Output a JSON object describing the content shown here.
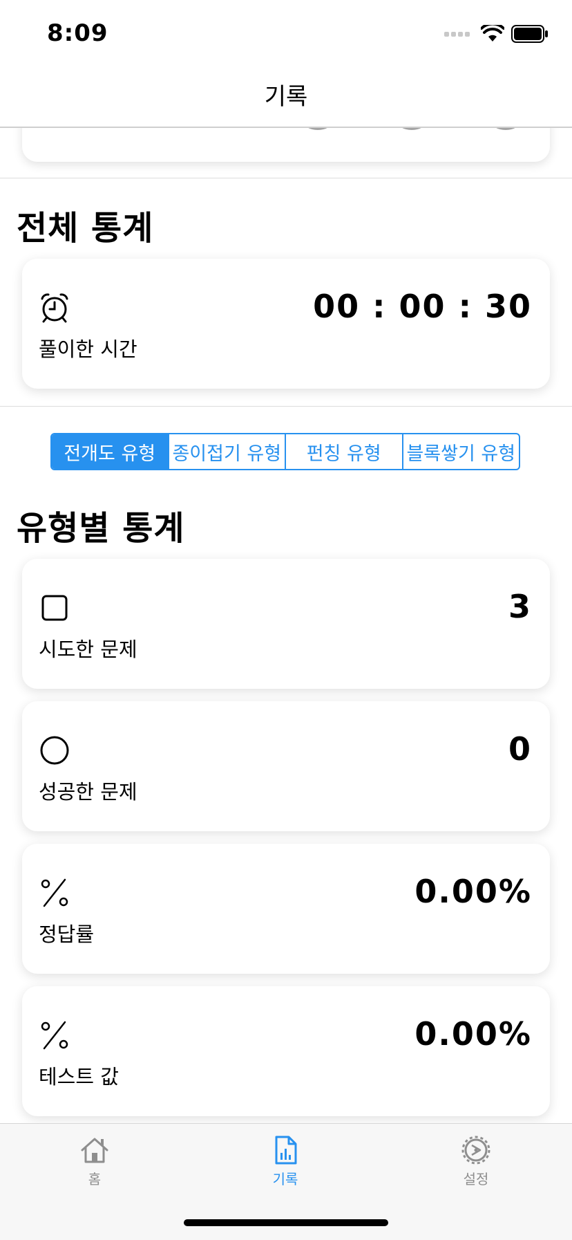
{
  "status_bar": {
    "time": "8:09"
  },
  "nav": {
    "title": "기록"
  },
  "overall_stats": {
    "title": "전체 통계",
    "time_card": {
      "icon": "alarm-clock-icon",
      "label": "풀이한 시간",
      "value": "00 : 00 : 30"
    }
  },
  "type_segments": {
    "items": [
      "전개도 유형",
      "종이접기 유형",
      "펀칭 유형",
      "블록쌓기 유형"
    ],
    "selected": "전개도 유형"
  },
  "type_stats": {
    "title": "유형별 통계",
    "cards": [
      {
        "icon": "square-icon",
        "label": "시도한 문제",
        "value": "3"
      },
      {
        "icon": "circle-icon",
        "label": "성공한 문제",
        "value": "0"
      },
      {
        "icon": "percent-icon",
        "label": "정답률",
        "value": "0.00%"
      },
      {
        "icon": "percent-icon",
        "label": "테스트 값",
        "value": "0.00%"
      }
    ]
  },
  "tab_bar": {
    "items": [
      {
        "label": "홈",
        "icon": "home-icon",
        "active": false
      },
      {
        "label": "기록",
        "icon": "chart-document-icon",
        "active": true
      },
      {
        "label": "설정",
        "icon": "gear-icon",
        "active": false
      }
    ]
  },
  "colors": {
    "accent": "#2791ef",
    "inactive": "#8e8e8e"
  }
}
